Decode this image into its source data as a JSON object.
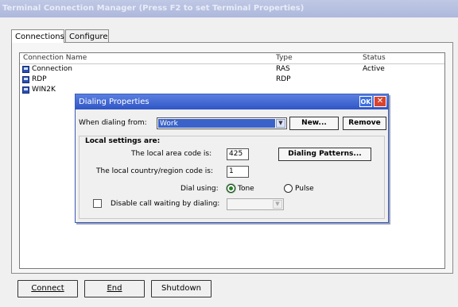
{
  "window": {
    "title": "Terminal Connection Manager (Press F2 to set Terminal Properties)"
  },
  "tabs": [
    {
      "label": "Connections",
      "active": true
    },
    {
      "label": "Configure",
      "active": false
    }
  ],
  "list": {
    "columns": [
      "Connection Name",
      "Type",
      "Status"
    ],
    "rows": [
      {
        "name": "Connection",
        "type": "RAS",
        "status": "Active",
        "icon": "connection-icon"
      },
      {
        "name": "RDP",
        "type": "RDP",
        "status": "",
        "icon": "connection-icon"
      },
      {
        "name": "WIN2K",
        "type": "",
        "status": "",
        "icon": "connection-icon"
      }
    ]
  },
  "buttons": {
    "connect": "Connect",
    "end": "End",
    "shutdown": "Shutdown"
  },
  "dialog": {
    "title": "Dialing Properties",
    "ok_label": "OK",
    "close_label": "✕",
    "when_dialing_from_label": "When dialing from:",
    "when_dialing_from_value": "Work",
    "new_label": "New...",
    "remove_label": "Remove",
    "local_settings_label": "Local settings are:",
    "area_code_label": "The local area code is:",
    "area_code_value": "425",
    "country_code_label": "The local country/region code is:",
    "country_code_value": "1",
    "dialing_patterns_label": "Dialing Patterns...",
    "dial_using_label": "Dial using:",
    "tone_label": "Tone",
    "pulse_label": "Pulse",
    "dial_mode": "Tone",
    "disable_call_waiting_label": "Disable call waiting by dialing:",
    "disable_call_waiting_checked": false,
    "call_waiting_value": ""
  },
  "colors": {
    "titlebar": "#aeb8dc",
    "dialog_title": "#2f55c6",
    "selection": "#3a62c8",
    "tone_radio": "#1a8a1a"
  }
}
